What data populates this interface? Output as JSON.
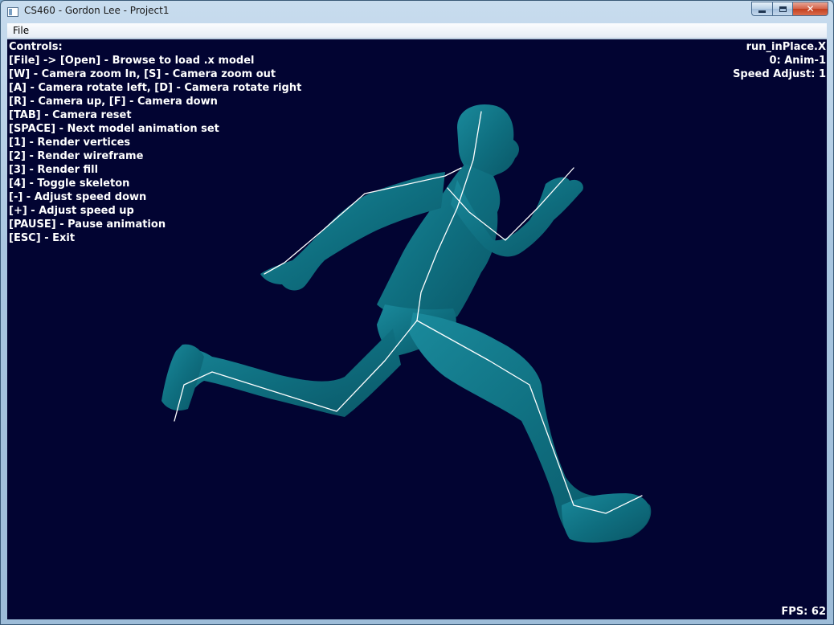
{
  "window": {
    "title": "CS460 - Gordon Lee - Project1",
    "controls": {
      "minimize_icon": "minimize-icon",
      "maximize_icon": "maximize-icon",
      "close_icon": "close-icon"
    }
  },
  "menu": {
    "file_label": "File"
  },
  "hud": {
    "controls_header": "Controls:",
    "controls": [
      "[File] -> [Open] - Browse to load .x model",
      "[W] - Camera zoom In, [S] - Camera zoom out",
      "[A] - Camera rotate left, [D] - Camera rotate right",
      "[R] - Camera up, [F] - Camera down",
      "[TAB] - Camera reset",
      "[SPACE] - Next model animation set",
      "[1] - Render vertices",
      "[2] - Render wireframe",
      "[3] - Render fill",
      "[4] - Toggle skeleton",
      "[-] - Adjust speed down",
      "[+] - Adjust speed up",
      "[PAUSE] - Pause animation",
      "[ESC] - Exit"
    ],
    "model_file": "run_inPlace.X",
    "animation_set": "0: Anim-1",
    "speed_adjust": "Speed Adjust: 1",
    "fps": "FPS: 62"
  },
  "colors": {
    "viewport_background": "#020432",
    "model_fill": "#0f6f80",
    "skeleton_line": "#ffffff",
    "hud_text": "#ffffff"
  }
}
